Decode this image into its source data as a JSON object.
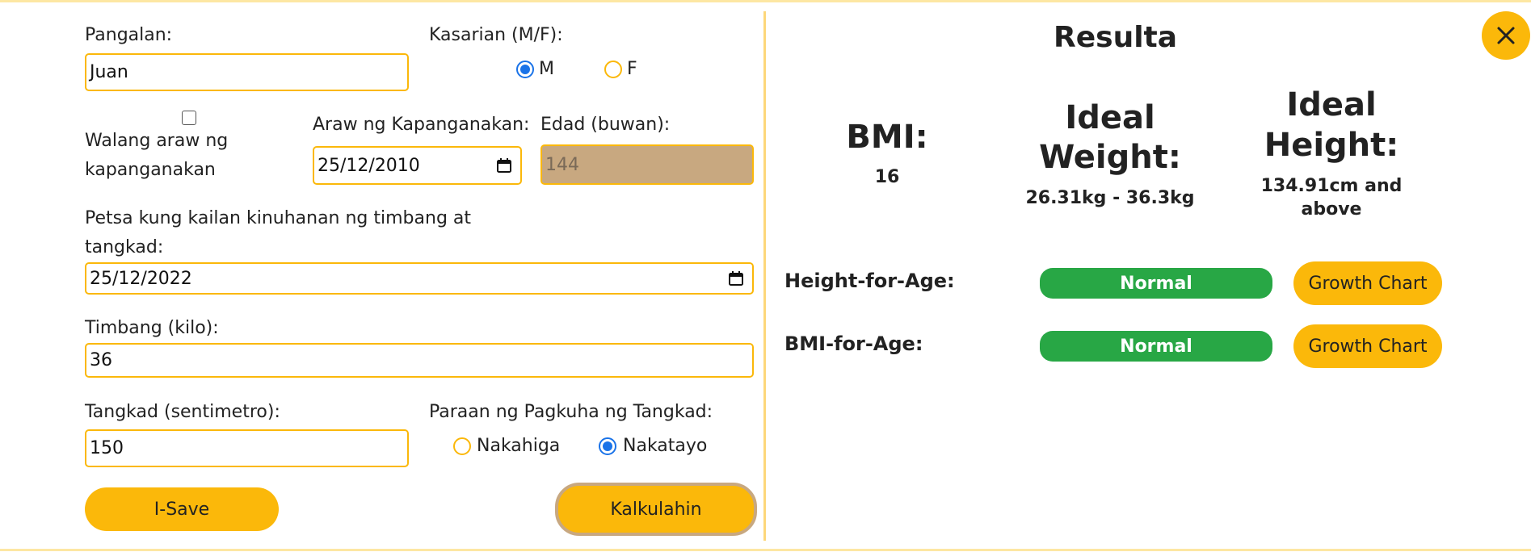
{
  "form": {
    "name_label": "Pangalan:",
    "name_value": "Juan",
    "sex_label": "Kasarian (M/F):",
    "sex_options": [
      "M",
      "F"
    ],
    "sex_selected": "M",
    "no_birthdate_label_line1": "Walang araw ng",
    "no_birthdate_label_line2": "kapanganakan",
    "birthdate_label": "Araw ng Kapanganakan:",
    "birthdate_value": "25/12/2010",
    "age_label": "Edad (buwan):",
    "age_value": "144",
    "measure_date_label_line1": "Petsa kung kailan kinuhanan ng timbang at",
    "measure_date_label_line2": "tangkad:",
    "measure_date_value": "25/12/2022",
    "weight_label": "Timbang (kilo):",
    "weight_value": "36",
    "height_label": "Tangkad (sentimetro):",
    "height_value": "150",
    "method_label": "Paraan ng Pagkuha ng Tangkad:",
    "method_options": [
      "Nakahiga",
      "Nakatayo"
    ],
    "method_selected": "Nakatayo",
    "save_button": "I-Save",
    "calculate_button": "Kalkulahin"
  },
  "results": {
    "title": "Resulta",
    "bmi_label": "BMI:",
    "bmi_value": "16",
    "ideal_weight_label_line1": "Ideal",
    "ideal_weight_label_line2": "Weight:",
    "ideal_weight_value": "26.31kg - 36.3kg",
    "ideal_height_label_line1": "Ideal",
    "ideal_height_label_line2": "Height:",
    "ideal_height_value_line1": "134.91cm and",
    "ideal_height_value_line2": "above",
    "rows": [
      {
        "label": "Height-for-Age:",
        "status": "Normal",
        "button": "Growth Chart"
      },
      {
        "label": "BMI-for-Age:",
        "status": "Normal",
        "button": "Growth Chart"
      }
    ]
  },
  "colors": {
    "accent": "#fbb80a",
    "status_normal": "#28a745",
    "radio_selected": "#1a73e8",
    "disabled_field": "#c8a880"
  },
  "icons": [
    "calendar-icon",
    "close-icon"
  ]
}
